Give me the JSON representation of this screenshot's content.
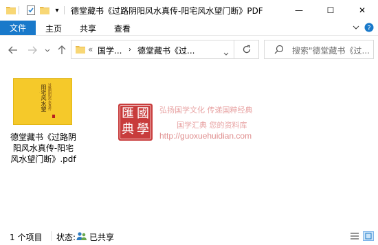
{
  "window": {
    "title": "德堂藏书《过路阴阳风水真传-阳宅风水望门断》PDF",
    "controls": {
      "minimize": "—",
      "maximize": "☐",
      "close": "✕"
    }
  },
  "ribbon": {
    "tabs": [
      {
        "label": "文件"
      },
      {
        "label": "主页"
      },
      {
        "label": "共享"
      },
      {
        "label": "查看"
      }
    ]
  },
  "nav": {
    "back_icon": "arrow-left-icon",
    "forward_icon": "arrow-right-icon",
    "up_icon": "arrow-up-icon",
    "address": {
      "overflow": "«",
      "segments": [
        "国学...",
        "德堂藏书《过..."
      ]
    },
    "search_placeholder": "搜索\"德堂藏书《过..."
  },
  "file": {
    "name": "德堂藏书《过路阴阳风水真传-阳宅风水望门断》.pdf",
    "thumbnail_title": "阳宅风水望门断",
    "thumbnail_subtitle": "过路阴阳风水真传"
  },
  "watermark": {
    "seal": [
      "匯",
      "國",
      "典",
      "學"
    ],
    "line1": "弘扬国学文化  传递国粹经典",
    "line2": "国学汇典  您的资料库",
    "url": "http://guoxuehuidian.com"
  },
  "status": {
    "count": "1 个项目",
    "state_label": "状态:",
    "state_value": "已共享"
  },
  "colors": {
    "accent": "#1979ca",
    "thumb": "#f5c92a",
    "seal": "#c83c3c",
    "watermark": "#e8a3a3"
  }
}
